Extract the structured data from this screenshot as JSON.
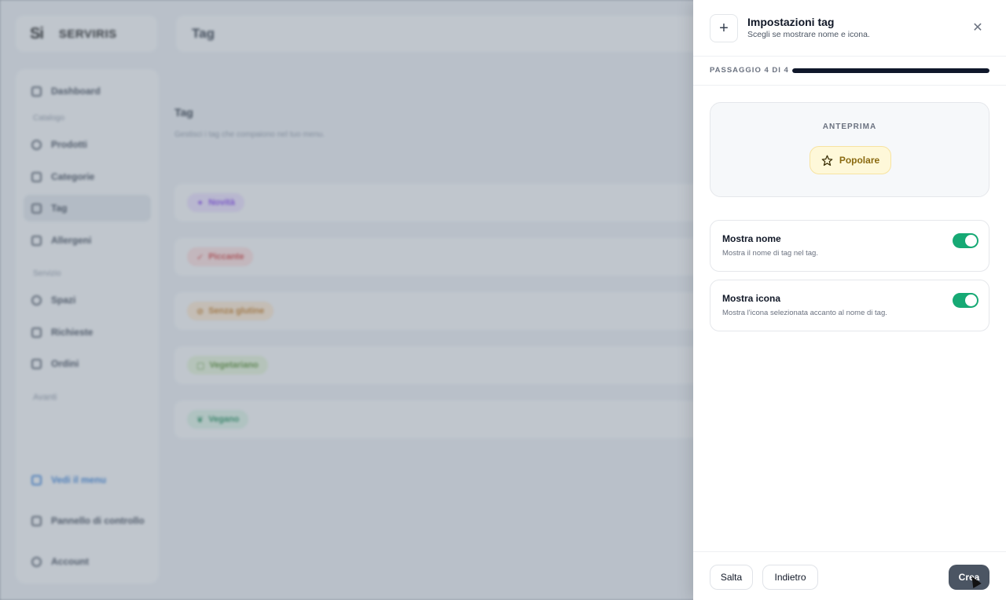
{
  "app": {
    "logo_mark": "Si",
    "logo_text": "SERVIRIS",
    "page_title": "Tag",
    "sidebar": {
      "items": [
        {
          "label": "Dashboard"
        },
        {
          "label": "Prodotti"
        },
        {
          "label": "Categorie"
        },
        {
          "label": "Tag"
        },
        {
          "label": "Allergeni"
        },
        {
          "label": "Spazi"
        },
        {
          "label": "Richieste"
        },
        {
          "label": "Ordini"
        }
      ],
      "sections": [
        "Catalogo",
        "Servizio"
      ],
      "more_label": "Avanti",
      "view_menu": "Vedi il menu",
      "control_panel": "Pannello di controllo",
      "account": "Account"
    },
    "content_title": "Tag",
    "content_subtitle": "Gestisci i tag che compaiono nel tuo menu.",
    "tags": [
      {
        "label": "Novità",
        "bg": "#e7ddfb",
        "fg": "#7c3aed"
      },
      {
        "label": "Piccante",
        "bg": "#fadcdc",
        "fg": "#d23b3b"
      },
      {
        "label": "Senza glutine",
        "bg": "#fbe7cf",
        "fg": "#c2761b"
      },
      {
        "label": "Vegetariano",
        "bg": "#e2f2d7",
        "fg": "#4f8a2a"
      },
      {
        "label": "Vegano",
        "bg": "#d9f1e4",
        "fg": "#178a55"
      }
    ]
  },
  "drawer": {
    "title": "Impostazioni tag",
    "subtitle": "Scegli se mostrare nome e icona.",
    "step_label": "PASSAGGIO 4 DI 4",
    "step_progress": 1.0,
    "preview_label": "ANTEPRIMA",
    "preview_chip": "Popolare",
    "options": [
      {
        "title": "Mostra nome",
        "desc": "Mostra il nome di tag nel tag.",
        "enabled": true
      },
      {
        "title": "Mostra icona",
        "desc": "Mostra l'icona selezionata accanto al nome di tag.",
        "enabled": true
      }
    ],
    "skip": "Salta",
    "back": "Indietro",
    "create": "Crea"
  },
  "colors": {
    "toggle_on": "#16a974",
    "accent_blue": "#2f7bd6",
    "preview_chip_bg": "#fef8d9"
  }
}
